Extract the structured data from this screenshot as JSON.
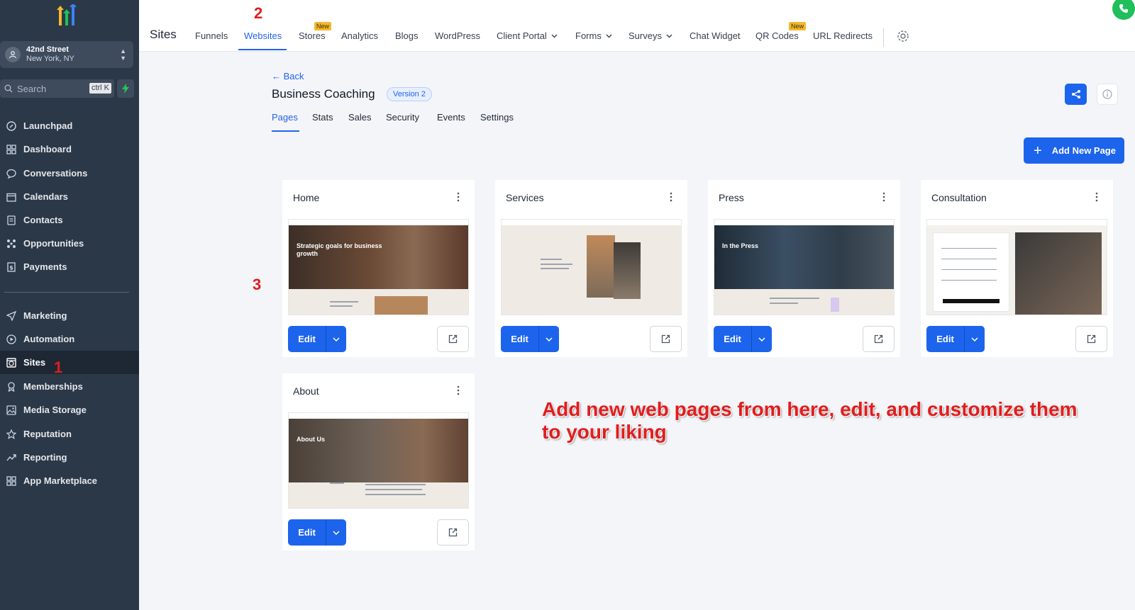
{
  "sidebar": {
    "location": {
      "name": "42nd Street",
      "city": "New York, NY"
    },
    "search": {
      "placeholder": "Search",
      "shortcut": "ctrl K"
    },
    "items": [
      {
        "label": "Launchpad",
        "icon": "launchpad-icon"
      },
      {
        "label": "Dashboard",
        "icon": "dashboard-icon"
      },
      {
        "label": "Conversations",
        "icon": "chat-icon"
      },
      {
        "label": "Calendars",
        "icon": "calendar-icon"
      },
      {
        "label": "Contacts",
        "icon": "contacts-icon"
      },
      {
        "label": "Opportunities",
        "icon": "opportunities-icon"
      },
      {
        "label": "Payments",
        "icon": "payments-icon"
      },
      {
        "label": "Marketing",
        "icon": "send-icon"
      },
      {
        "label": "Automation",
        "icon": "automation-icon"
      },
      {
        "label": "Sites",
        "icon": "sites-icon",
        "active": true
      },
      {
        "label": "Memberships",
        "icon": "memberships-icon"
      },
      {
        "label": "Media Storage",
        "icon": "image-icon"
      },
      {
        "label": "Reputation",
        "icon": "star-icon"
      },
      {
        "label": "Reporting",
        "icon": "trend-icon"
      },
      {
        "label": "App Marketplace",
        "icon": "grid-icon"
      }
    ]
  },
  "topbar": {
    "title": "Sites",
    "links": [
      "Funnels",
      "Websites",
      "Stores",
      "Analytics",
      "Blogs",
      "WordPress",
      "Client Portal",
      "Forms",
      "Surveys",
      "Chat Widget",
      "QR Codes",
      "URL Redirects"
    ],
    "active": "Websites",
    "new_badge": "New"
  },
  "header": {
    "back": "← Back",
    "title": "Business Coaching",
    "version": "Version 2",
    "tabs": [
      "Pages",
      "Stats",
      "Sales",
      "Security",
      "Events",
      "Settings"
    ],
    "active_tab": "Pages",
    "add_button": "Add New Page"
  },
  "pages": [
    {
      "title": "Home",
      "hero_text": "Strategic goals for business growth"
    },
    {
      "title": "Services",
      "hero_text": ""
    },
    {
      "title": "Press",
      "hero_text": "In the Press"
    },
    {
      "title": "Consultation",
      "hero_text": ""
    },
    {
      "title": "About",
      "hero_text": "About Us"
    }
  ],
  "card_actions": {
    "edit": "Edit"
  },
  "annotations": {
    "step1": "1",
    "step2": "2",
    "step3": "3",
    "note": "Add new web pages from here, edit, and customize them to your liking"
  },
  "colors": {
    "primary": "#1d64ec",
    "sidebar_bg": "#2b3848",
    "annotation": "#e11d1d",
    "new_badge": "#f5b82e"
  }
}
